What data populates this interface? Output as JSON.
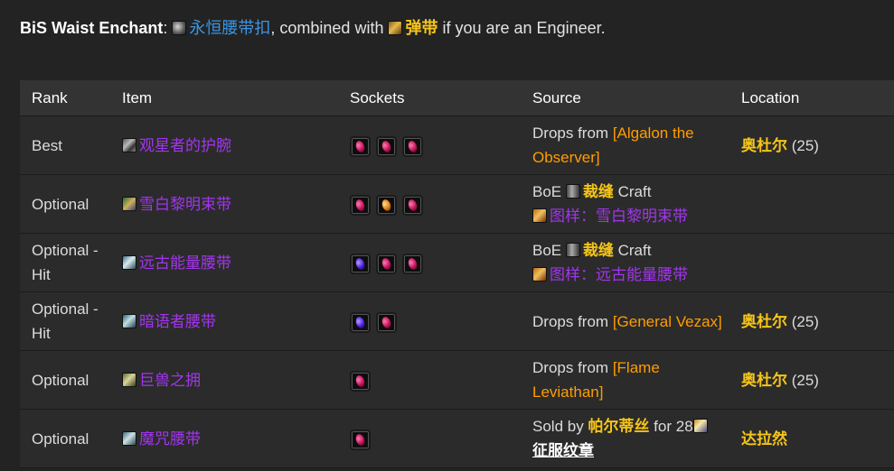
{
  "enchant": {
    "label": "BiS Waist Enchant",
    "colon": ":",
    "item_icon": "gear-icon",
    "item": "永恒腰带扣",
    "middle": ", combined with",
    "alt_icon": "belt-icon",
    "alt_item": "弹带",
    "suffix": "if you are an Engineer."
  },
  "table": {
    "headers": [
      "Rank",
      "Item",
      "Sockets",
      "Source",
      "Location"
    ],
    "rows": [
      {
        "rank": "Best",
        "item": "观星者的护腕",
        "item_icon": "bracer-icon",
        "gems": [
          "red",
          "red",
          "red"
        ],
        "source_prefix": "Drops from",
        "source_boss": "[Algalon the Observer]",
        "location": "奥杜尔",
        "location_size": "(25)"
      },
      {
        "rank": "Optional",
        "item": "雪白黎明束带",
        "item_icon": "waist-icon",
        "gems": [
          "red",
          "orange",
          "red"
        ],
        "source_prefix": "BoE",
        "source_prof": "裁缝",
        "source_craft": "Craft",
        "source_pattern": "图样：雪白黎明束带",
        "location": "",
        "location_size": ""
      },
      {
        "rank": "Optional - Hit",
        "item": "远古能量腰带",
        "item_icon": "waist-icon",
        "gems": [
          "purple",
          "red",
          "red"
        ],
        "source_prefix": "BoE",
        "source_prof": "裁缝",
        "source_craft": "Craft",
        "source_pattern": "图样：远古能量腰带",
        "location": "",
        "location_size": ""
      },
      {
        "rank": "Optional - Hit",
        "item": "暗语者腰带",
        "item_icon": "waist-icon",
        "gems": [
          "purple",
          "red"
        ],
        "source_prefix": "Drops from",
        "source_boss": "[General Vezax]",
        "location": "奥杜尔",
        "location_size": "(25)"
      },
      {
        "rank": "Optional",
        "item": "巨兽之拥",
        "item_icon": "waist-icon",
        "gems": [
          "red"
        ],
        "source_prefix": "Drops from",
        "source_boss": "[Flame Leviathan]",
        "location": "奥杜尔",
        "location_size": "(25)"
      },
      {
        "rank": "Optional",
        "item": "魔咒腰带",
        "item_icon": "waist-icon",
        "gems": [
          "red"
        ],
        "source_prefix": "Sold by",
        "source_vendor": "帕尔蒂丝",
        "source_for": "for 28",
        "source_currency": "征服纹章",
        "location": "达拉然",
        "location_size": ""
      }
    ]
  },
  "colors": {
    "background": "#232323",
    "header_bg": "#333333",
    "epic": "#a335ee",
    "blue_link": "#3b95e5",
    "gold": "#f5c518",
    "boss_orange": "#ff9d00"
  }
}
